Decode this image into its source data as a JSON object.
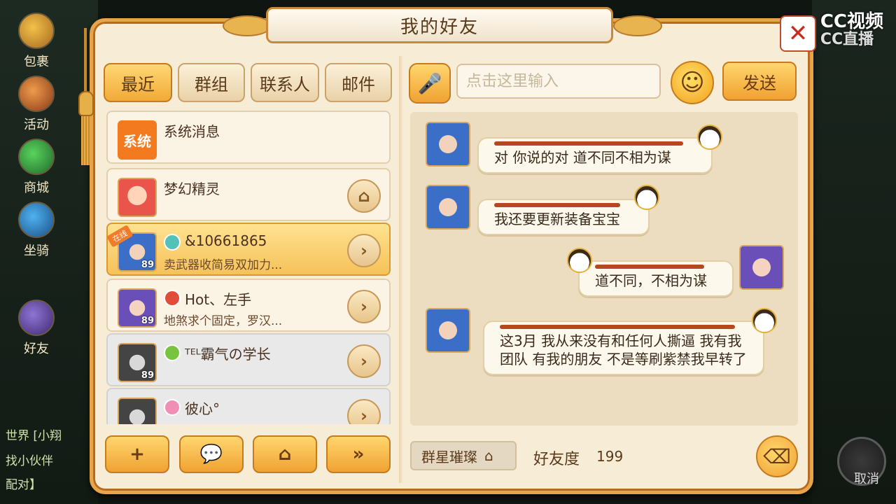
{
  "background": {
    "side_buttons": [
      "包裹",
      "活动",
      "商城",
      "坐骑",
      "好友"
    ],
    "chat_lines": [
      "世界 [小翔",
      "找小伙伴",
      "配对】"
    ],
    "cancel_label": "取消",
    "watermark": [
      "CC视频",
      "CC直播"
    ]
  },
  "panel": {
    "title": "我的好友",
    "close_icon": "close-icon"
  },
  "tabs": [
    {
      "label": "最近",
      "active": true
    },
    {
      "label": "群组",
      "active": false
    },
    {
      "label": "联系人",
      "active": false
    },
    {
      "label": "邮件",
      "active": false
    }
  ],
  "friends": [
    {
      "avatar": "系统",
      "name": "系统消息",
      "signature": "",
      "level": "",
      "action_icon": ""
    },
    {
      "avatar": "",
      "name": "梦幻精灵",
      "signature": "",
      "level": "",
      "action_icon": "home-icon"
    },
    {
      "avatar": "",
      "name": "&10661865",
      "signature": "卖武器收简易双加力...",
      "level": "89",
      "action_icon": "chevron-right-icon",
      "online_tag": "在线"
    },
    {
      "avatar": "",
      "name": "Hot、左手",
      "signature": "地煞求个固定，罗汉...",
      "level": "89",
      "action_icon": "chevron-right-icon"
    },
    {
      "avatar": "",
      "name": "ᵀᴱᴸ霸气の学长",
      "signature": "",
      "level": "89",
      "action_icon": "chevron-right-icon"
    },
    {
      "avatar": "",
      "name": "彼心°",
      "signature": "",
      "level": "",
      "action_icon": "chevron-right-icon"
    }
  ],
  "bottom_buttons": [
    {
      "icon": "add-friend-icon",
      "glyph": "+"
    },
    {
      "icon": "chat-icon",
      "glyph": "💬"
    },
    {
      "icon": "home-icon",
      "glyph": "⌂"
    },
    {
      "icon": "double-chevron-icon",
      "glyph": "»"
    }
  ],
  "input": {
    "placeholder": "点击这里输入",
    "value": "",
    "send_label": "发送"
  },
  "messages": [
    {
      "side": "left",
      "text": "对 你说的对 道不同不相为谋"
    },
    {
      "side": "left",
      "text": "我还要更新装备宝宝"
    },
    {
      "side": "right",
      "text": "道不同，不相为谋"
    },
    {
      "side": "left",
      "text": "这3月 我从来没有和任何人撕逼 我有我团队 有我的朋友 不是等刷紫禁我早转了"
    }
  ],
  "footer": {
    "group_name": "群星璀璨",
    "favor_label": "好友度",
    "favor_value": "199"
  }
}
